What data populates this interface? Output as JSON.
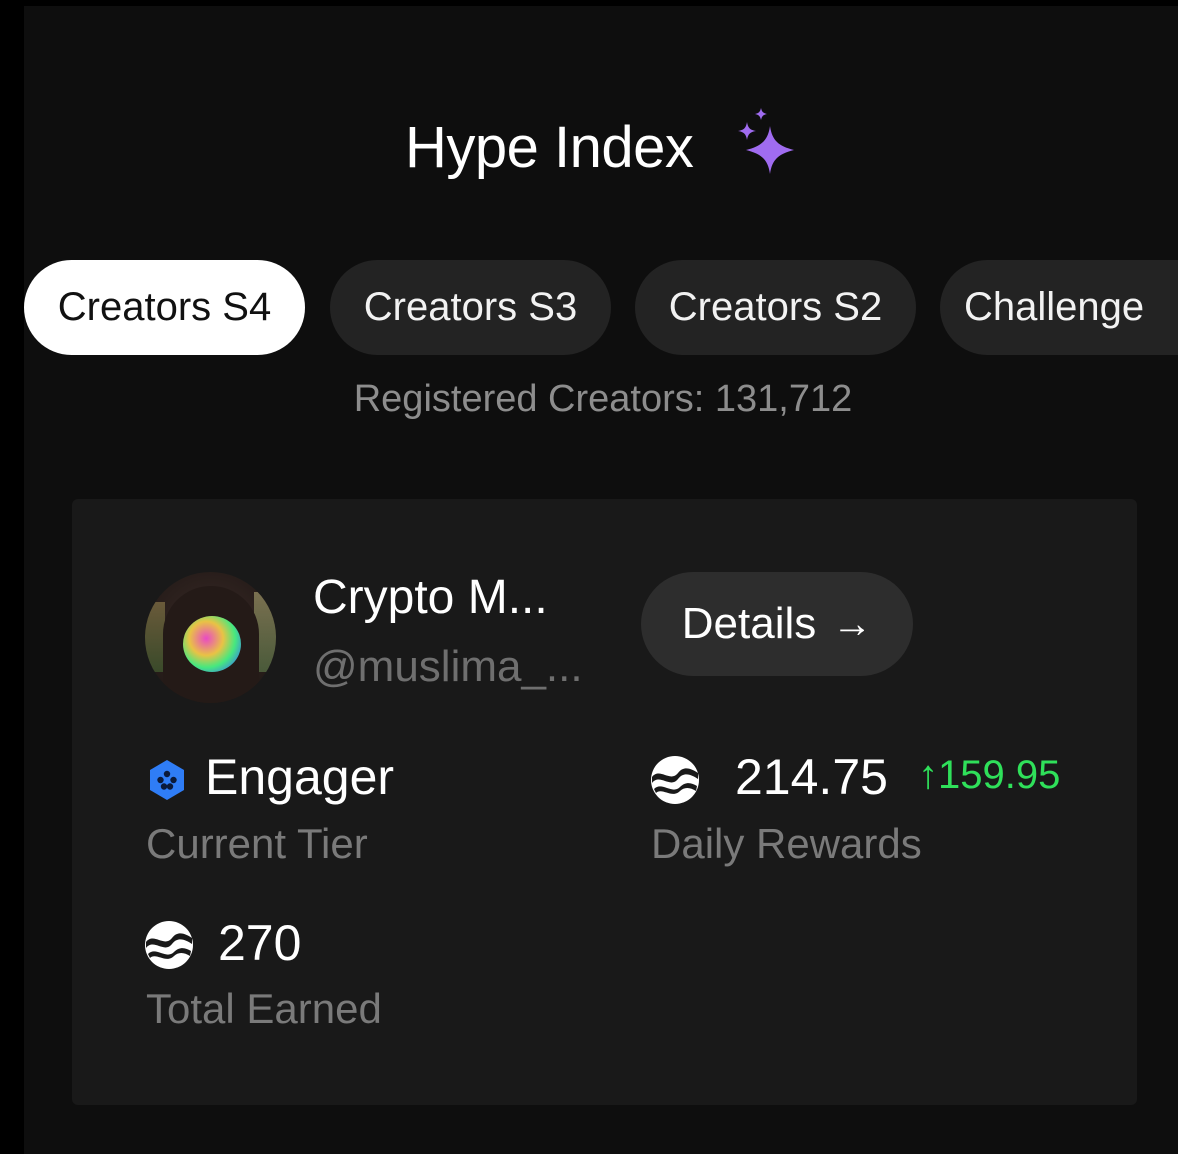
{
  "header": {
    "title": "Hype Index",
    "title_icon": "sparkle-icon",
    "sparkle_color": "#a06cf0"
  },
  "tabs": [
    {
      "label": "Creators S4",
      "active": true
    },
    {
      "label": "Creators S3",
      "active": false
    },
    {
      "label": "Creators S2",
      "active": false
    },
    {
      "label": "Challenge",
      "active": false
    }
  ],
  "registered": {
    "text": "Registered Creators: 131,712"
  },
  "profile": {
    "name": "Crypto M...",
    "handle": "@muslima_...",
    "details_label": "Details",
    "details_icon": "arrow-right-icon"
  },
  "stats": {
    "tier": {
      "value": "Engager",
      "label": "Current Tier",
      "icon": "tier-hexagon-icon",
      "icon_color": "#2f7df6"
    },
    "daily_rewards": {
      "value": "214.75",
      "change": "↑159.95",
      "change_color": "#2fe05a",
      "label": "Daily Rewards",
      "icon": "coin-icon"
    },
    "total_earned": {
      "value": "270",
      "label": "Total Earned",
      "icon": "coin-icon"
    }
  }
}
